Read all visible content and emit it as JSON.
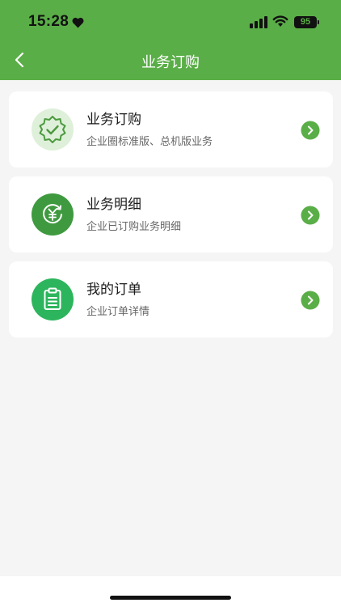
{
  "status_bar": {
    "time": "15:28",
    "battery": "95"
  },
  "nav": {
    "title": "业务订购",
    "back_icon": "chevron-left-icon"
  },
  "colors": {
    "brand_green": "#5aae47",
    "card_bg": "#ffffff",
    "page_bg": "#f5f5f5"
  },
  "cards": [
    {
      "title": "业务订购",
      "subtitle": "企业圈标准版、总机版业务",
      "icon": "badge-check-icon"
    },
    {
      "title": "业务明细",
      "subtitle": "企业已订购业务明细",
      "icon": "yen-icon"
    },
    {
      "title": "我的订单",
      "subtitle": "企业订单详情",
      "icon": "clipboard-icon"
    }
  ]
}
